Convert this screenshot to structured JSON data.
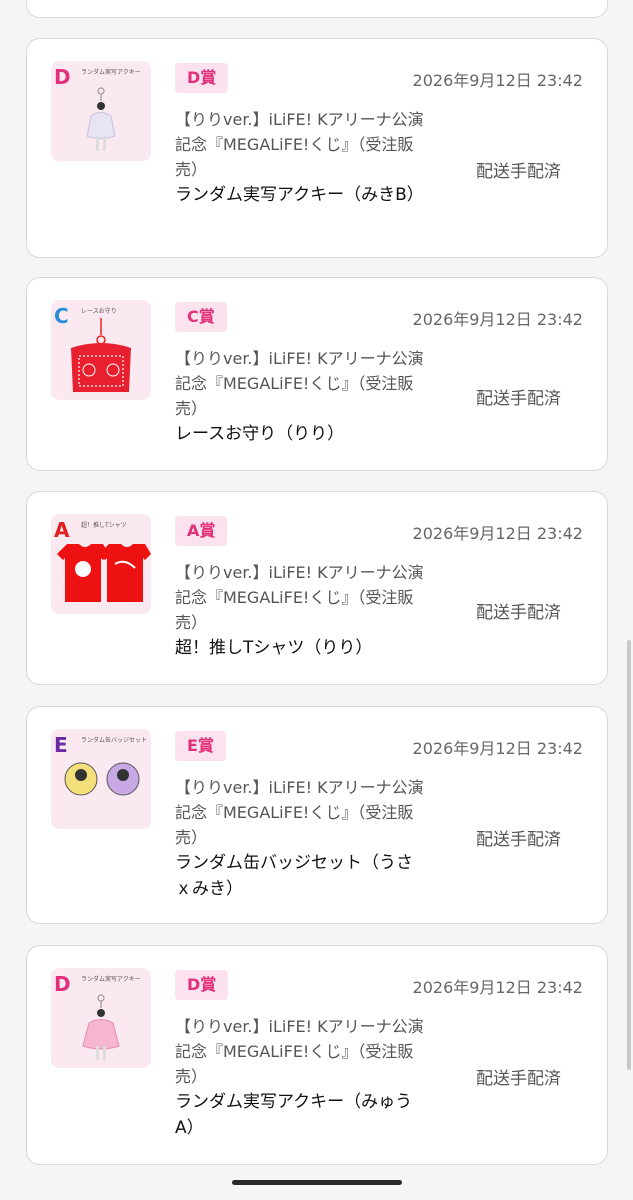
{
  "cards": [
    {
      "thumb_grade": "D",
      "thumb_caption": "ランダム実写アクキー",
      "badge": "D賞",
      "date": "2026年9月12日 23:42",
      "title": "【りりver.】iLiFE! Kアリーナ公演記念『MEGALiFE!くじ』（受注販売）",
      "item": "ランダム実写アクキー（みきB）",
      "status": "配送手配済"
    },
    {
      "thumb_grade": "C",
      "thumb_caption": "レースお守り",
      "badge": "C賞",
      "date": "2026年9月12日 23:42",
      "title": "【りりver.】iLiFE! Kアリーナ公演記念『MEGALiFE!くじ』（受注販売）",
      "item": "レースお守り（りり）",
      "status": "配送手配済"
    },
    {
      "thumb_grade": "A",
      "thumb_caption": "超！推しTシャツ",
      "badge": "A賞",
      "date": "2026年9月12日 23:42",
      "title": "【りりver.】iLiFE! Kアリーナ公演記念『MEGALiFE!くじ』（受注販売）",
      "item": "超！推しTシャツ（りり）",
      "status": "配送手配済"
    },
    {
      "thumb_grade": "E",
      "thumb_caption": "ランダム缶バッジセット",
      "badge": "E賞",
      "date": "2026年9月12日 23:42",
      "title": "【りりver.】iLiFE! Kアリーナ公演記念『MEGALiFE!くじ』（受注販売）",
      "item": "ランダム缶バッジセット（うさｘみき）",
      "status": "配送手配済"
    },
    {
      "thumb_grade": "D",
      "thumb_caption": "ランダム実写アクキー",
      "badge": "D賞",
      "date": "2026年9月12日 23:42",
      "title": "【りりver.】iLiFE! Kアリーナ公演記念『MEGALiFE!くじ』（受注販売）",
      "item": "ランダム実写アクキー（みゅうA）",
      "status": "配送手配済"
    }
  ],
  "colors": {
    "badge_bg": "#fce1ee",
    "badge_text": "#e0317a",
    "grade_d": "#e0317a",
    "grade_c": "#2a8fd6",
    "grade_a": "#e02020",
    "grade_e": "#6a2aa0"
  }
}
